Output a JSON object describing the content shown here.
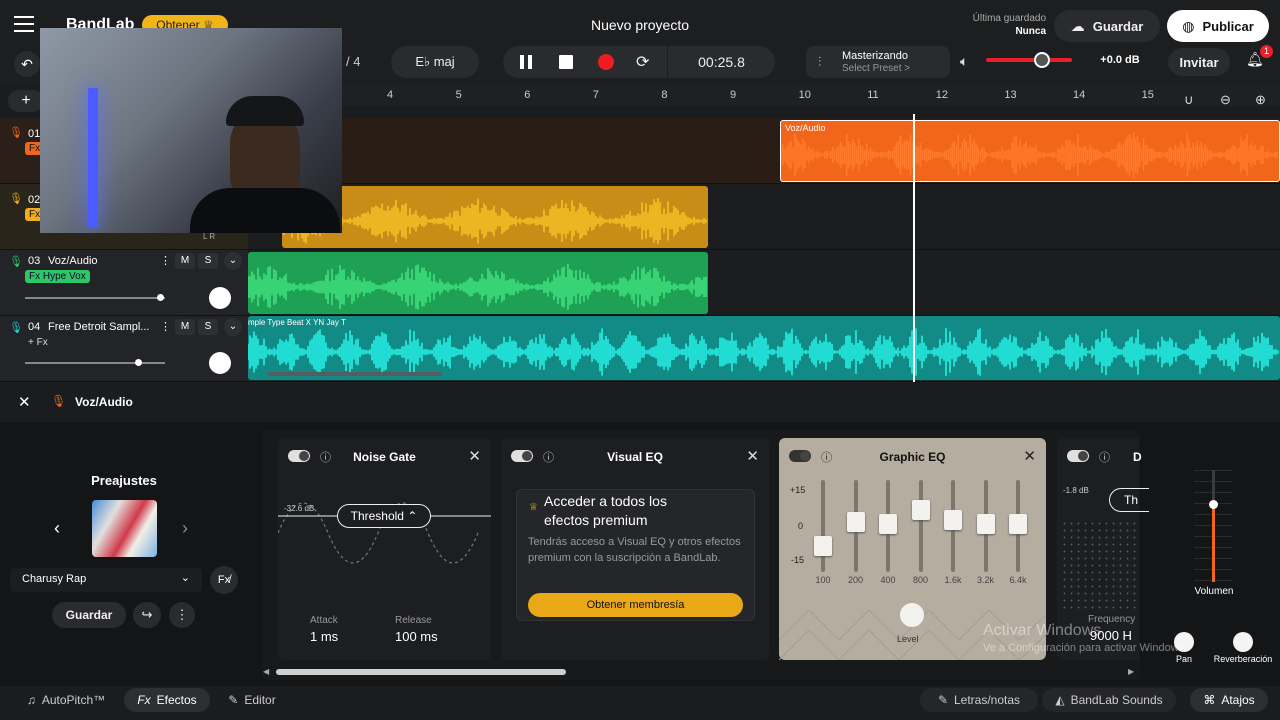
{
  "header": {
    "brand": "BandLab",
    "get_button": "Obtener",
    "project_title": "Nuevo proyecto",
    "last_saved_label": "Última guardado",
    "last_saved_value": "Nunca",
    "save_button": "Guardar",
    "publish_button": "Publicar"
  },
  "transport": {
    "time_sig_denominator": "/ 4",
    "key": "E♭ maj",
    "time": "00:25.8",
    "mastering_label": "Masterizando",
    "mastering_preset": "Select Preset >",
    "gain": "+0.0 dB",
    "invite": "Invitar",
    "notifications": "1"
  },
  "ruler": {
    "bars": [
      "4",
      "5",
      "6",
      "7",
      "8",
      "9",
      "10",
      "11",
      "12",
      "13",
      "14",
      "15"
    ]
  },
  "tracks": [
    {
      "num": "01",
      "name": "Voz/Audio",
      "fx": "Fx",
      "clip_label": "Voz/Audio",
      "color": "#f2661c",
      "volume": 0.7
    },
    {
      "num": "02",
      "name": "",
      "fx": "Fx",
      "clip_label": "",
      "color": "#f1ad1b",
      "volume": 0.7
    },
    {
      "num": "03",
      "name": "Voz/Audio",
      "fx": "Fx Hype Vox",
      "clip_label": "",
      "color": "#2ec766",
      "volume": 0.97
    },
    {
      "num": "04",
      "name": "Free Detroit Sampl...",
      "fx": "+ Fx",
      "clip_label": "mple Type Beat X YN Jay T",
      "color": "#1cd8cf",
      "volume": 0.82
    }
  ],
  "track_buttons": {
    "mute": "M",
    "solo": "S"
  },
  "panel": {
    "track_name": "Voz/Audio",
    "presets_title": "Preajustes",
    "preset_name": "Charusy Rap",
    "save_button": "Guardar"
  },
  "effects": {
    "noise_gate": {
      "title": "Noise Gate",
      "threshold_value": "-32.6 dB",
      "threshold_label": "Threshold",
      "attack_label": "Attack",
      "attack_value": "1 ms",
      "release_label": "Release",
      "release_value": "100 ms"
    },
    "visual_eq": {
      "title": "Visual EQ",
      "premium_title": "Acceder a todos los efectos premium",
      "premium_text": "Tendrás acceso a Visual EQ y otros efectos premium con la suscripción a BandLab.",
      "premium_button": "Obtener membresía"
    },
    "graphic_eq": {
      "title": "Graphic EQ",
      "scale": [
        "+15",
        "0",
        "-15"
      ],
      "bands": [
        "100",
        "200",
        "400",
        "800",
        "1.6k",
        "3.2k",
        "6.4k"
      ],
      "band_levels": [
        -0.5,
        0.1,
        0.05,
        0.4,
        0.15,
        0.05,
        0.05
      ],
      "level_label": "Level"
    },
    "partial": {
      "title": "D",
      "value": "-1.8 dB",
      "param": "Th",
      "freq_label": "Frequency",
      "freq_value": "9000 H"
    }
  },
  "right_controls": {
    "volume_label": "Volumen",
    "volume_level": 0.7,
    "pan_label": "Pan",
    "reverb_label": "Reverberación"
  },
  "watermark": {
    "line1": "Activar Windows",
    "line2": "Ve a Configuración para activar Windows."
  },
  "bottom": {
    "autopitch": "AutoPitch™",
    "effects": "Efectos",
    "editor": "Editor",
    "lyrics": "Letras/notas",
    "sounds": "BandLab Sounds",
    "shortcuts": "Atajos"
  }
}
